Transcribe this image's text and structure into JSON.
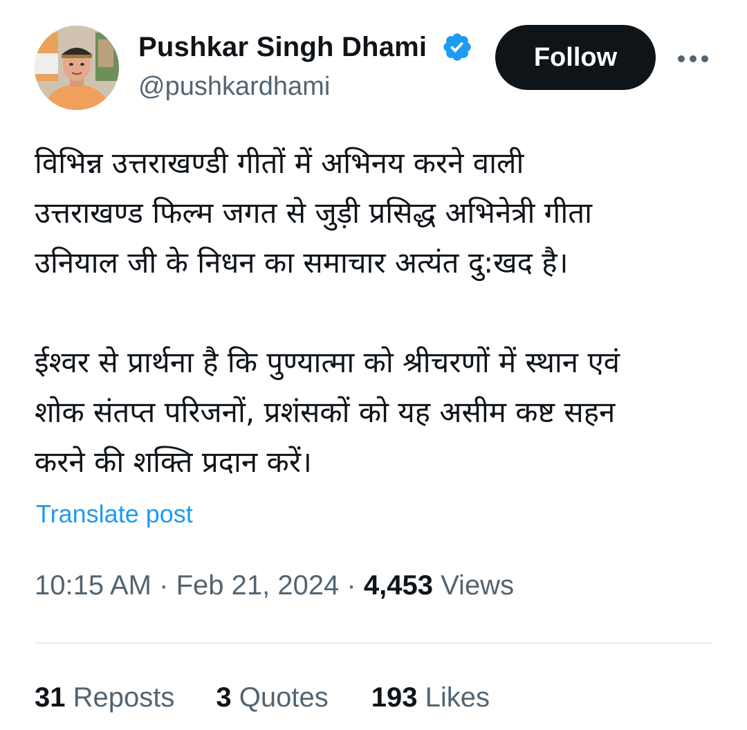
{
  "author": {
    "display_name": "Pushkar Singh Dhami",
    "handle": "@pushkardhami",
    "verified": true,
    "avatar_icon": "profile-photo"
  },
  "actions": {
    "follow_label": "Follow",
    "more_icon": "more-horizontal-icon"
  },
  "post": {
    "paragraphs": [
      "विभिन्न उत्तराखण्डी गीतों में अभिनय करने वाली\nउत्तराखण्ड फिल्म जगत से जुड़ी प्रसिद्ध अभिनेत्री गीता\nउनियाल जी के निधन का समाचार अत्यंत दु:खद है।",
      "ईश्वर से प्रार्थना है कि पुण्यात्मा को श्रीचरणों में स्थान एवं\nशोक संतप्त परिजनों, प्रशंसकों को यह असीम कष्ट सहन\nकरने की शक्ति प्रदान करें।"
    ],
    "translate_label": "Translate post"
  },
  "meta": {
    "time": "10:15 AM",
    "separator": " · ",
    "date": "Feb 21, 2024",
    "views_count": "4,453",
    "views_label": "Views"
  },
  "stats": {
    "reposts_count": "31",
    "reposts_label": "Reposts",
    "quotes_count": "3",
    "quotes_label": "Quotes",
    "likes_count": "193",
    "likes_label": "Likes"
  },
  "colors": {
    "text_primary": "#0f1419",
    "text_secondary": "#536471",
    "link": "#1d9bf0",
    "verified": "#1d9bf0",
    "button_bg": "#0f1419"
  }
}
